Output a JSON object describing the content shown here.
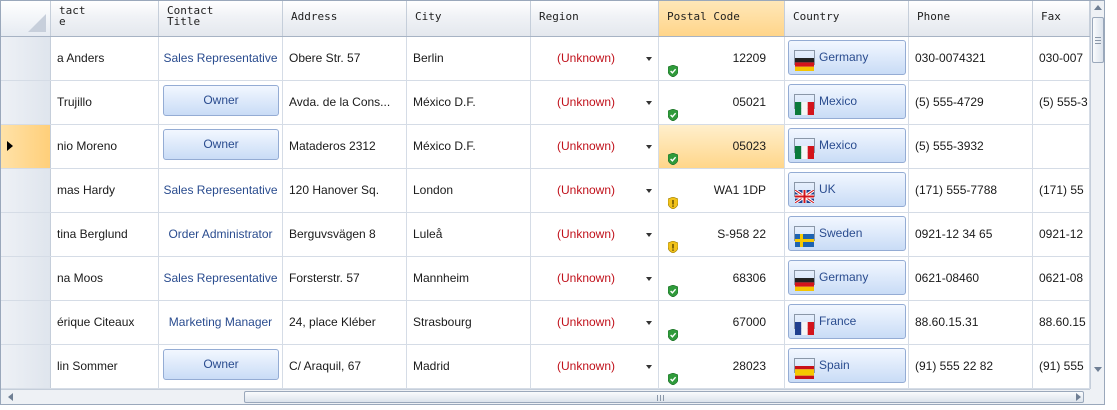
{
  "columns": [
    {
      "key": "name",
      "label": "tact\ne"
    },
    {
      "key": "title",
      "label": "Contact\nTitle"
    },
    {
      "key": "address",
      "label": "Address"
    },
    {
      "key": "city",
      "label": "City"
    },
    {
      "key": "region",
      "label": "Region"
    },
    {
      "key": "postal",
      "label": "Postal Code"
    },
    {
      "key": "country",
      "label": "Country"
    },
    {
      "key": "phone",
      "label": "Phone"
    },
    {
      "key": "fax",
      "label": "Fax"
    }
  ],
  "rows": [
    {
      "name": "a Anders",
      "title": "Sales Representative",
      "title_style": "text",
      "address": "Obere Str. 57",
      "city": "Berlin",
      "region": "(Unknown)",
      "shield": "green",
      "postal": "12209",
      "country": "Germany",
      "flag": "germany",
      "phone": "030-0074321",
      "fax": "030-007"
    },
    {
      "name": "Trujillo",
      "title": "Owner",
      "title_style": "button",
      "address": "Avda. de la Cons...",
      "city": "México D.F.",
      "region": "(Unknown)",
      "shield": "green",
      "postal": "05021",
      "country": "Mexico",
      "flag": "mexico",
      "phone": "(5) 555-4729",
      "fax": "(5) 555-3"
    },
    {
      "name": "nio Moreno",
      "title": "Owner",
      "title_style": "button",
      "address": "Mataderos  2312",
      "city": "México D.F.",
      "region": "(Unknown)",
      "shield": "green",
      "postal": "05023",
      "country": "Mexico",
      "flag": "mexico",
      "phone": "(5) 555-3932",
      "fax": ""
    },
    {
      "name": "mas Hardy",
      "title": "Sales Representative",
      "title_style": "text",
      "address": "120 Hanover Sq.",
      "city": "London",
      "region": "(Unknown)",
      "shield": "yellow",
      "postal": "WA1 1DP",
      "country": "UK",
      "flag": "uk",
      "phone": "(171) 555-7788",
      "fax": "(171) 55"
    },
    {
      "name": "tina Berglund",
      "title": "Order Administrator",
      "title_style": "text",
      "address": "Berguvsvägen  8",
      "city": "Luleå",
      "region": "(Unknown)",
      "shield": "yellow",
      "postal": "S-958 22",
      "country": "Sweden",
      "flag": "sweden",
      "phone": "0921-12 34 65",
      "fax": "0921-12"
    },
    {
      "name": "na Moos",
      "title": "Sales Representative",
      "title_style": "text",
      "address": "Forsterstr. 57",
      "city": "Mannheim",
      "region": "(Unknown)",
      "shield": "green",
      "postal": "68306",
      "country": "Germany",
      "flag": "germany",
      "phone": "0621-08460",
      "fax": "0621-08"
    },
    {
      "name": "érique Citeaux",
      "title": "Marketing Manager",
      "title_style": "text",
      "address": "24, place Kléber",
      "city": "Strasbourg",
      "region": "(Unknown)",
      "shield": "green",
      "postal": "67000",
      "country": "France",
      "flag": "france",
      "phone": "88.60.15.31",
      "fax": "88.60.15"
    },
    {
      "name": "lin Sommer",
      "title": "Owner",
      "title_style": "button",
      "address": "C/ Araquil, 67",
      "city": "Madrid",
      "region": "(Unknown)",
      "shield": "green",
      "postal": "28023",
      "country": "Spain",
      "flag": "spain",
      "phone": "(91) 555 22 82",
      "fax": "(91) 555"
    }
  ],
  "selection": {
    "row": 2,
    "column": "postal"
  },
  "colors": {
    "accent": "#2a4c8f",
    "region_text": "#c0101a",
    "selection": "#ffd58a",
    "border": "#9aa8bb"
  }
}
